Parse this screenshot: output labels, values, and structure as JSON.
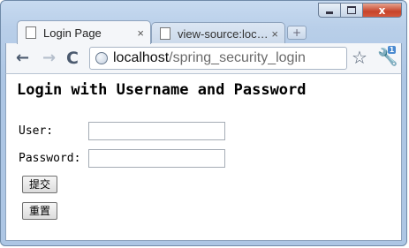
{
  "window": {
    "controls": {
      "minimize": "",
      "maximize": "",
      "close": "x"
    }
  },
  "tabs": [
    {
      "title": "Login Page",
      "active": true,
      "close": "×"
    },
    {
      "title": "view-source:loc…",
      "active": false,
      "close": "×"
    }
  ],
  "toolbar": {
    "back_icon": "←",
    "forward_icon": "→",
    "reload_icon": "C",
    "url_host": "localhost",
    "url_path": "/spring_security_login",
    "star_icon": "☆",
    "wrench_icon": "🔧",
    "wrench_badge": "1"
  },
  "page": {
    "heading": "Login with Username and Password",
    "user_label": "User:",
    "password_label": "Password:",
    "user_value": "",
    "password_value": "",
    "submit_label": "提交",
    "reset_label": "重置"
  }
}
